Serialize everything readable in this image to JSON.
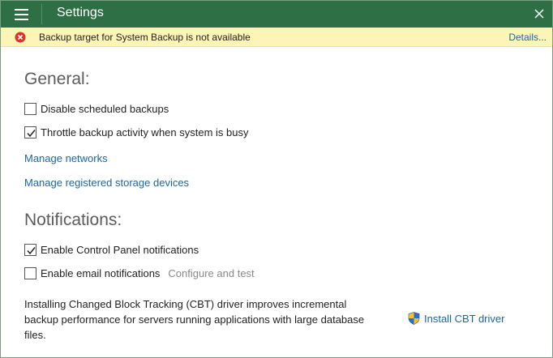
{
  "window": {
    "title": "Settings"
  },
  "titlebar": {
    "menu_icon": "hamburger-menu-icon",
    "close_icon": "close-icon"
  },
  "banner": {
    "icon": "error-icon",
    "message": "Backup target for System Backup is not available",
    "details_link": "Details..."
  },
  "general": {
    "heading": "General:",
    "options": [
      {
        "label": "Disable scheduled backups",
        "checked": false
      },
      {
        "label": "Throttle backup activity when system is busy",
        "checked": true
      }
    ],
    "links": [
      {
        "label": "Manage networks"
      },
      {
        "label": "Manage registered storage devices"
      }
    ]
  },
  "notifications": {
    "heading": "Notifications:",
    "options": [
      {
        "label": "Enable Control Panel notifications",
        "checked": true
      },
      {
        "label": "Enable email notifications",
        "checked": false,
        "secondary": "Configure and test"
      }
    ]
  },
  "cbt": {
    "description": "Installing Changed Block Tracking (CBT) driver improves incremental backup performance for servers running applications with large database files.",
    "install_label": "Install CBT driver",
    "install_icon": "uac-shield-icon"
  },
  "colors": {
    "titlebar": "#2f6f45",
    "banner": "#fdf5b5",
    "error": "#d9352c",
    "link": "#1a66a8"
  }
}
